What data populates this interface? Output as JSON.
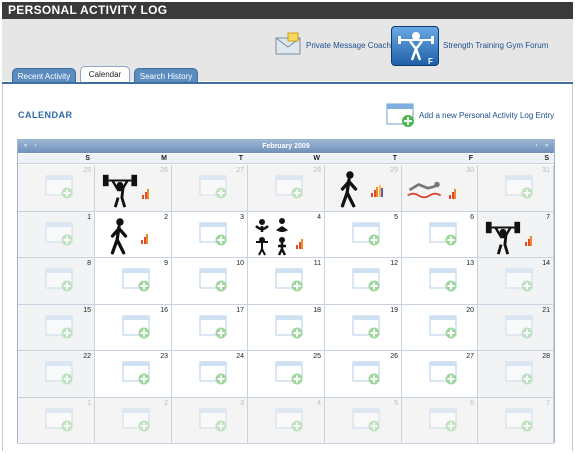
{
  "app": {
    "title": "PERSONAL ACTIVITY LOG"
  },
  "header": {
    "message_link": "Private Message Coach",
    "gym_link": "Strength Training Gym Forum"
  },
  "tabs": [
    {
      "label": "Recent Activity"
    },
    {
      "label": "Calendar"
    },
    {
      "label": "Search History"
    }
  ],
  "main": {
    "section_title": "CALENDAR",
    "add_entry_label": "Add a new Personal Activity Log Entry"
  },
  "calendar": {
    "month_title": "February 2009",
    "weekdays": [
      "S",
      "M",
      "T",
      "W",
      "T",
      "F",
      "S"
    ],
    "weeks": [
      [
        {
          "day": "25",
          "other": true
        },
        {
          "day": "26",
          "other": true,
          "activity": "weightlifting"
        },
        {
          "day": "27",
          "other": true
        },
        {
          "day": "28",
          "other": true
        },
        {
          "day": "29",
          "other": true,
          "activity": "walking"
        },
        {
          "day": "30",
          "other": true,
          "activity": "swimming"
        },
        {
          "day": "31",
          "other": true
        }
      ],
      [
        {
          "day": "1"
        },
        {
          "day": "2",
          "activity": "walking"
        },
        {
          "day": "3"
        },
        {
          "day": "4",
          "activity": "yoga-group"
        },
        {
          "day": "5"
        },
        {
          "day": "6"
        },
        {
          "day": "7",
          "activity": "weightlifting"
        }
      ],
      [
        {
          "day": "8"
        },
        {
          "day": "9"
        },
        {
          "day": "10"
        },
        {
          "day": "11"
        },
        {
          "day": "12"
        },
        {
          "day": "13"
        },
        {
          "day": "14"
        }
      ],
      [
        {
          "day": "15"
        },
        {
          "day": "16"
        },
        {
          "day": "17"
        },
        {
          "day": "18"
        },
        {
          "day": "19"
        },
        {
          "day": "20"
        },
        {
          "day": "21"
        }
      ],
      [
        {
          "day": "22"
        },
        {
          "day": "23"
        },
        {
          "day": "24"
        },
        {
          "day": "25"
        },
        {
          "day": "26"
        },
        {
          "day": "27"
        },
        {
          "day": "28"
        }
      ],
      [
        {
          "day": "1",
          "other": true
        },
        {
          "day": "2",
          "other": true
        },
        {
          "day": "3",
          "other": true
        },
        {
          "day": "4",
          "other": true
        },
        {
          "day": "5",
          "other": true
        },
        {
          "day": "6",
          "other": true
        },
        {
          "day": "7",
          "other": true
        }
      ]
    ]
  },
  "colors": {
    "title_bar": "#3a3a3a",
    "tab_blue": "#5b8cc0",
    "accent_blue": "#2d6aa8",
    "bar_red": "#e24a2b",
    "bar_yellow": "#f2c230"
  }
}
